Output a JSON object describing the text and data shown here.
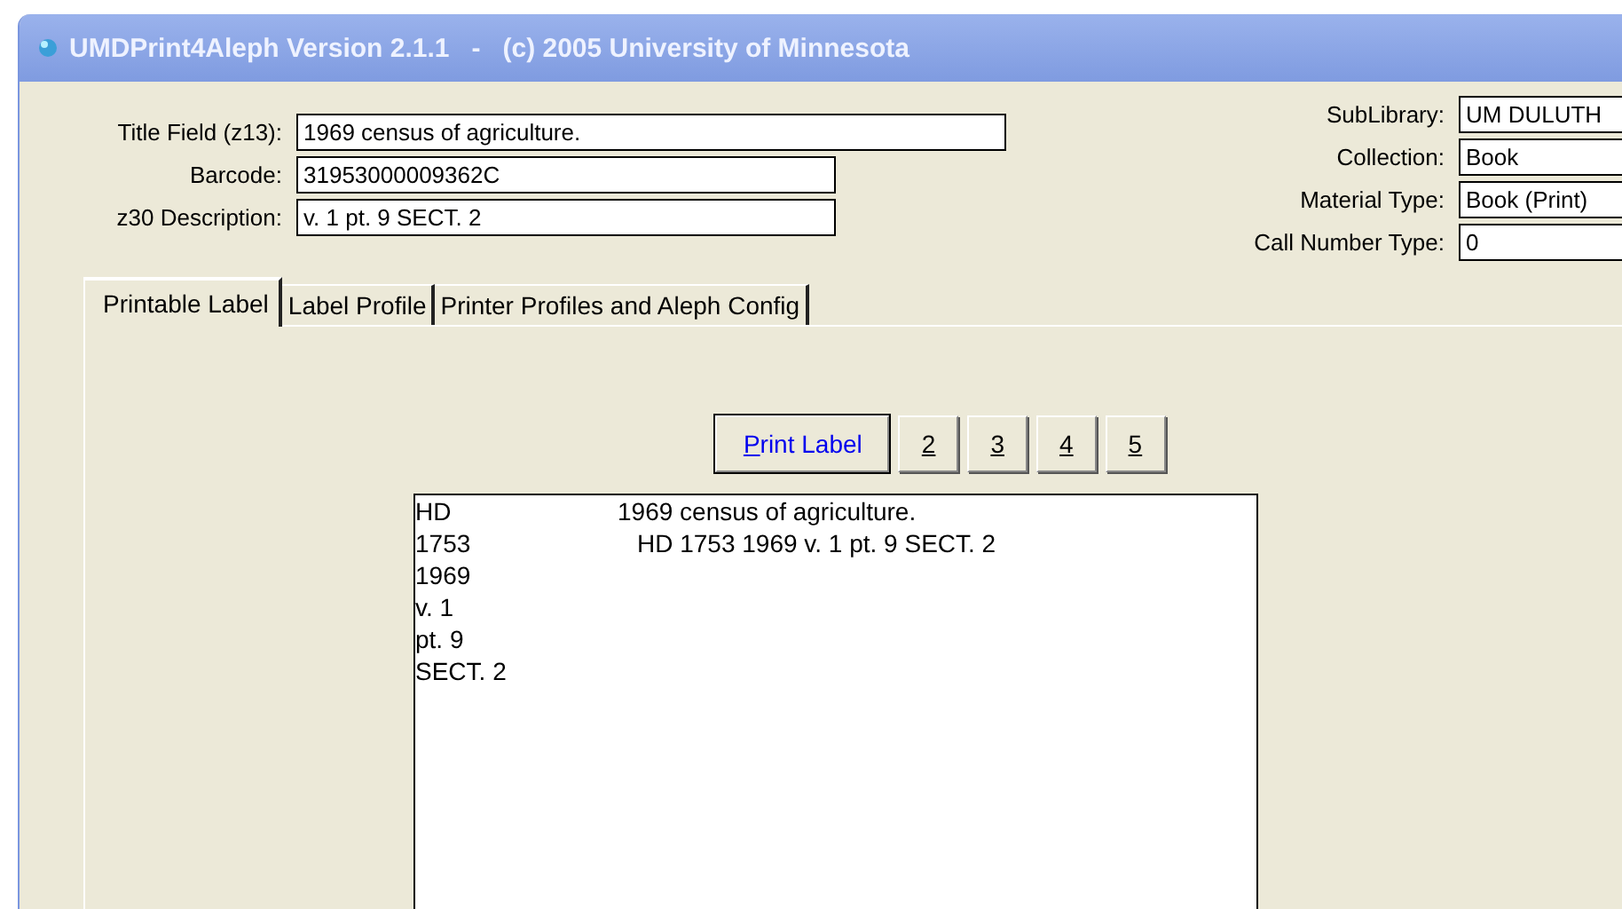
{
  "window": {
    "title": "UMDPrint4Aleph Version 2.1.1   -   (c) 2005 University of Minnesota"
  },
  "left_fields": [
    {
      "label": "Title Field (z13):",
      "value": "1969 census of agriculture."
    },
    {
      "label": "Barcode:",
      "value": "31953000009362C"
    },
    {
      "label": "z30 Description:",
      "value": "v. 1 pt. 9 SECT. 2"
    }
  ],
  "right_fields": [
    {
      "label": "SubLibrary:",
      "value": "UM DULUTH"
    },
    {
      "label": "Collection:",
      "value": "Book"
    },
    {
      "label": "Material Type:",
      "value": "Book (Print)"
    },
    {
      "label": "Call Number Type:",
      "value": "0"
    }
  ],
  "tabs": [
    {
      "label": "Printable Label",
      "selected": true
    },
    {
      "label": "Label Profile",
      "selected": false
    },
    {
      "label": "Printer Profiles and Aleph Config",
      "selected": false
    }
  ],
  "buttons": [
    {
      "label": "Print Label",
      "focused": true
    },
    {
      "label": "2",
      "focused": false
    },
    {
      "label": "3",
      "focused": false
    },
    {
      "label": "4",
      "focused": false
    },
    {
      "label": "5",
      "focused": false
    }
  ],
  "preview": {
    "spine_lines": [
      "HD",
      "1753",
      "1969",
      "v. 1",
      "pt. 9",
      "SECT. 2"
    ],
    "label_lines": [
      "1969 census of agriculture.",
      "HD 1753 1969 v. 1 pt. 9 SECT. 2"
    ]
  }
}
